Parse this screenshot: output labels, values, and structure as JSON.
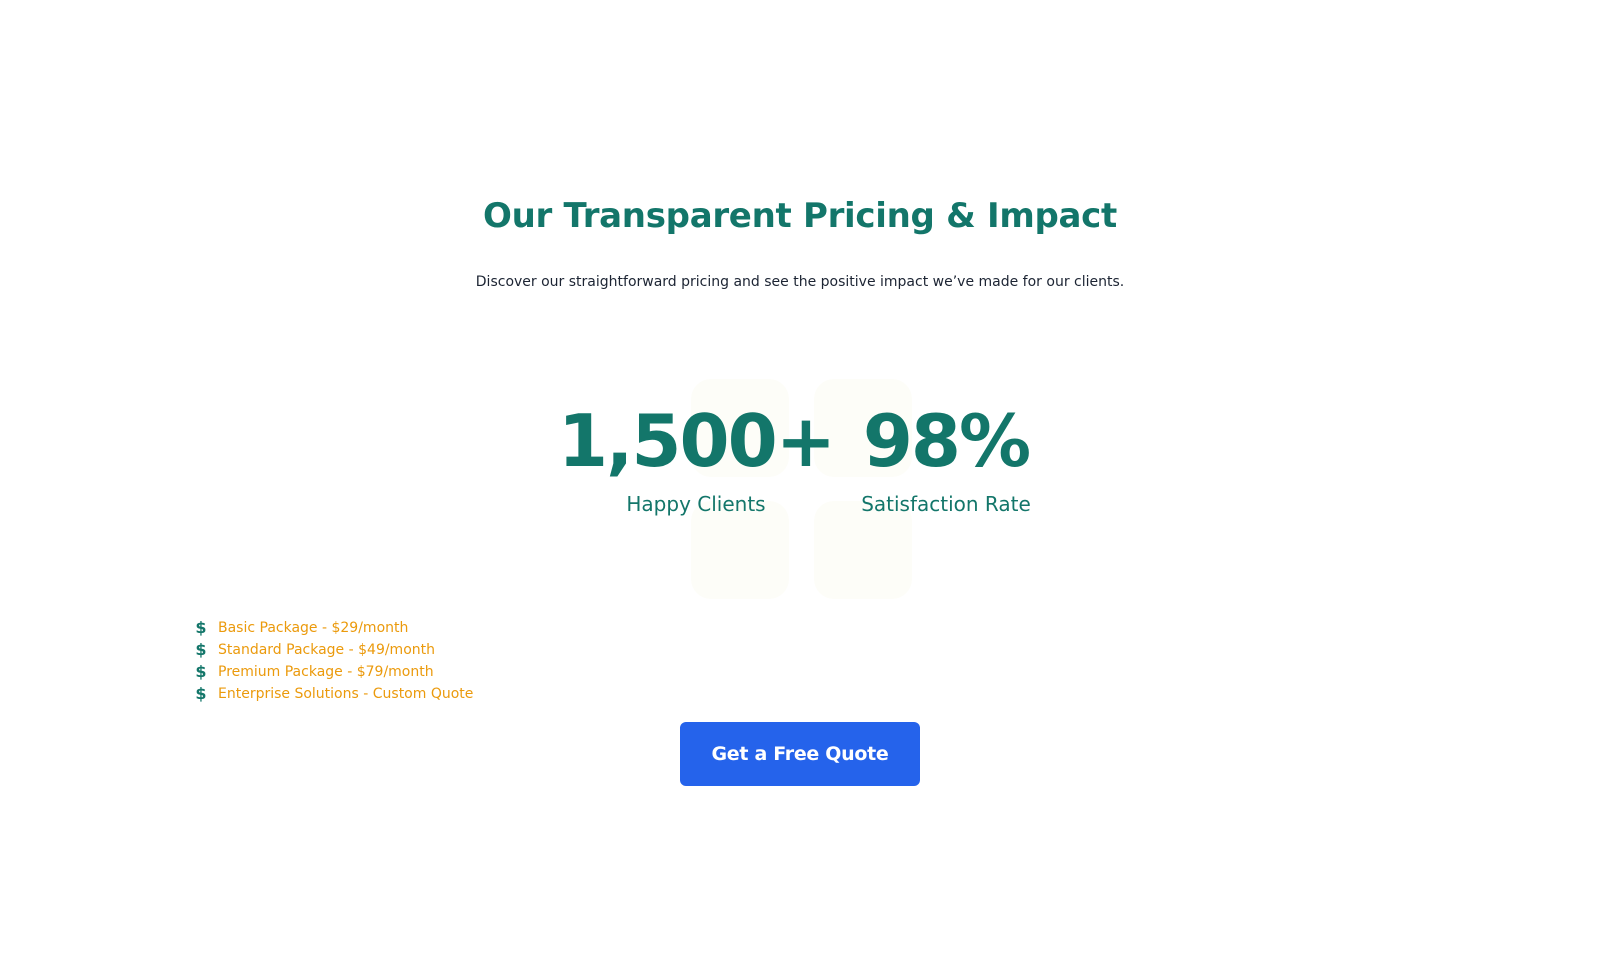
{
  "header": {
    "title": "Our Transparent Pricing & Impact",
    "subtitle": "Discover our straightforward pricing and see the positive impact we’ve made for our clients."
  },
  "stats": [
    {
      "value": "1,500+",
      "label": "Happy Clients"
    },
    {
      "value": "98%",
      "label": "Satisfaction Rate"
    }
  ],
  "pricing": {
    "icon": "dollar-icon",
    "items": [
      "Basic Package - $29/month",
      "Standard Package - $49/month",
      "Premium Package - $79/month",
      "Enterprise Solutions - Custom Quote"
    ]
  },
  "cta": {
    "label": "Get a Free Quote"
  },
  "colors": {
    "primary": "#13766a",
    "accent": "#eb9a0c",
    "button": "#2563eb",
    "text": "#1c2433"
  }
}
